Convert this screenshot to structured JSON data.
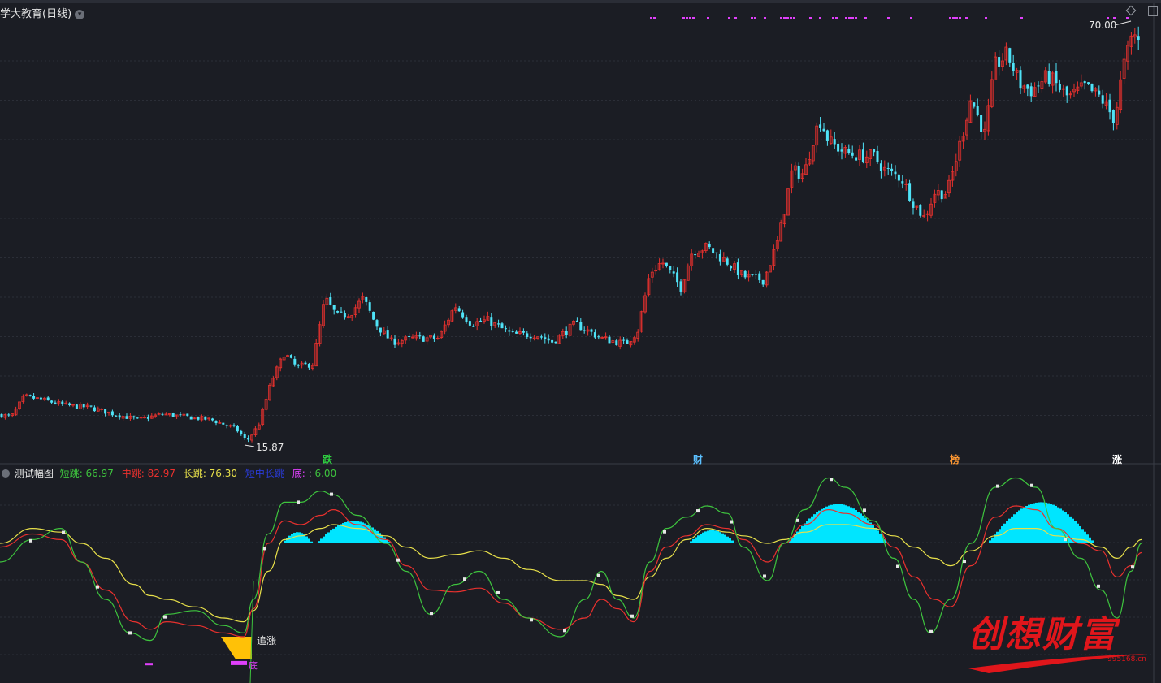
{
  "header": {
    "title": "学大教育(日线)",
    "price_high_label": "70.00",
    "price_low_label": "15.87"
  },
  "markers": [
    {
      "text": "跌",
      "color": "#2ecc40"
    },
    {
      "text": "财",
      "color": "#5bc0ff"
    },
    {
      "text": "榜",
      "color": "#ff9933"
    },
    {
      "text": "涨",
      "color": "#ffffff"
    }
  ],
  "indicator": {
    "name": "测试幅图",
    "items": [
      {
        "label": "短跳",
        "value": "66.97",
        "color": "#3ec43e"
      },
      {
        "label": "中跳",
        "value": "82.97",
        "color": "#e8312e"
      },
      {
        "label": "长跳",
        "value": "76.30",
        "color": "#e8e04a"
      },
      {
        "label": "短中长跳",
        "value": "",
        "color": "#2a3bd9"
      },
      {
        "label": "底",
        "value": "6.00",
        "color": "#e040fb"
      }
    ],
    "annotation_chase": "追涨",
    "annotation_bottom": "底"
  },
  "colors": {
    "up": "#e8312e",
    "down": "#4fe3f7",
    "background": "#1b1d24",
    "grid": "#2b2e37",
    "short": "#3ec43e",
    "mid": "#e8312e",
    "long": "#e8e04a",
    "fill": "#00e5ff",
    "dots": "#e040fb",
    "bottom_fill": "#ffc107"
  },
  "brand": {
    "logo_text": "创想财富",
    "logo_url": "995168.cn"
  },
  "chart_data": [
    {
      "type": "candlestick",
      "title": "学大教育(日线)",
      "annotations": [
        {
          "label": "70.00",
          "role": "high"
        },
        {
          "label": "15.87",
          "role": "low"
        }
      ],
      "close_trend": [
        [
          0,
          19.5
        ],
        [
          14,
          19.2
        ],
        [
          30,
          22.0
        ],
        [
          50,
          21.6
        ],
        [
          80,
          20.8
        ],
        [
          110,
          20.5
        ],
        [
          140,
          19.6
        ],
        [
          170,
          18.8
        ],
        [
          200,
          19.6
        ],
        [
          230,
          19.2
        ],
        [
          260,
          18.8
        ],
        [
          290,
          17.6
        ],
        [
          304,
          15.87
        ],
        [
          318,
          18.0
        ],
        [
          334,
          24.0
        ],
        [
          350,
          28.0
        ],
        [
          365,
          26.0
        ],
        [
          385,
          26.5
        ],
        [
          400,
          35.5
        ],
        [
          415,
          33.0
        ],
        [
          432,
          33.5
        ],
        [
          447,
          35.5
        ],
        [
          462,
          32.0
        ],
        [
          482,
          29.5
        ],
        [
          510,
          30.0
        ],
        [
          540,
          30.0
        ],
        [
          560,
          34.5
        ],
        [
          580,
          32.0
        ],
        [
          600,
          32.5
        ],
        [
          630,
          30.5
        ],
        [
          660,
          30.5
        ],
        [
          680,
          29.5
        ],
        [
          708,
          32.0
        ],
        [
          740,
          30.0
        ],
        [
          770,
          29.2
        ],
        [
          785,
          31.0
        ],
        [
          800,
          39.0
        ],
        [
          815,
          40.5
        ],
        [
          838,
          37.0
        ],
        [
          852,
          42.0
        ],
        [
          870,
          42.5
        ],
        [
          895,
          40.5
        ],
        [
          915,
          38.5
        ],
        [
          940,
          38.0
        ],
        [
          958,
          43.5
        ],
        [
          975,
          53.0
        ],
        [
          990,
          52.5
        ],
        [
          1002,
          58.0
        ],
        [
          1010,
          60.0
        ],
        [
          1020,
          57.0
        ],
        [
          1040,
          55.5
        ],
        [
          1060,
          55.0
        ],
        [
          1075,
          55.0
        ],
        [
          1090,
          53.0
        ],
        [
          1110,
          52.0
        ],
        [
          1125,
          48.5
        ],
        [
          1138,
          46.5
        ],
        [
          1150,
          50.0
        ],
        [
          1166,
          50.0
        ],
        [
          1180,
          56.0
        ],
        [
          1195,
          63.0
        ],
        [
          1212,
          58.0
        ],
        [
          1225,
          67.5
        ],
        [
          1240,
          69.0
        ],
        [
          1255,
          65.0
        ],
        [
          1270,
          64.0
        ],
        [
          1290,
          66.0
        ],
        [
          1315,
          63.0
        ],
        [
          1335,
          64.5
        ],
        [
          1355,
          63.0
        ],
        [
          1372,
          60.0
        ],
        [
          1382,
          67.0
        ],
        [
          1395,
          72.0
        ],
        [
          1405,
          70.0
        ]
      ],
      "special_signals": [
        "跌",
        "财",
        "榜",
        "涨"
      ]
    },
    {
      "type": "line",
      "title": "测试幅图",
      "series": [
        {
          "name": "短跳",
          "last": 66.97,
          "color": "#3ec43e"
        },
        {
          "name": "中跳",
          "last": 82.97,
          "color": "#e8312e"
        },
        {
          "name": "长跳",
          "last": 76.3,
          "color": "#e8e04a"
        },
        {
          "name": "底",
          "last": 6.0,
          "color": "#e040fb"
        }
      ],
      "ylim": [
        0,
        100
      ],
      "reference_line": 70
    }
  ]
}
